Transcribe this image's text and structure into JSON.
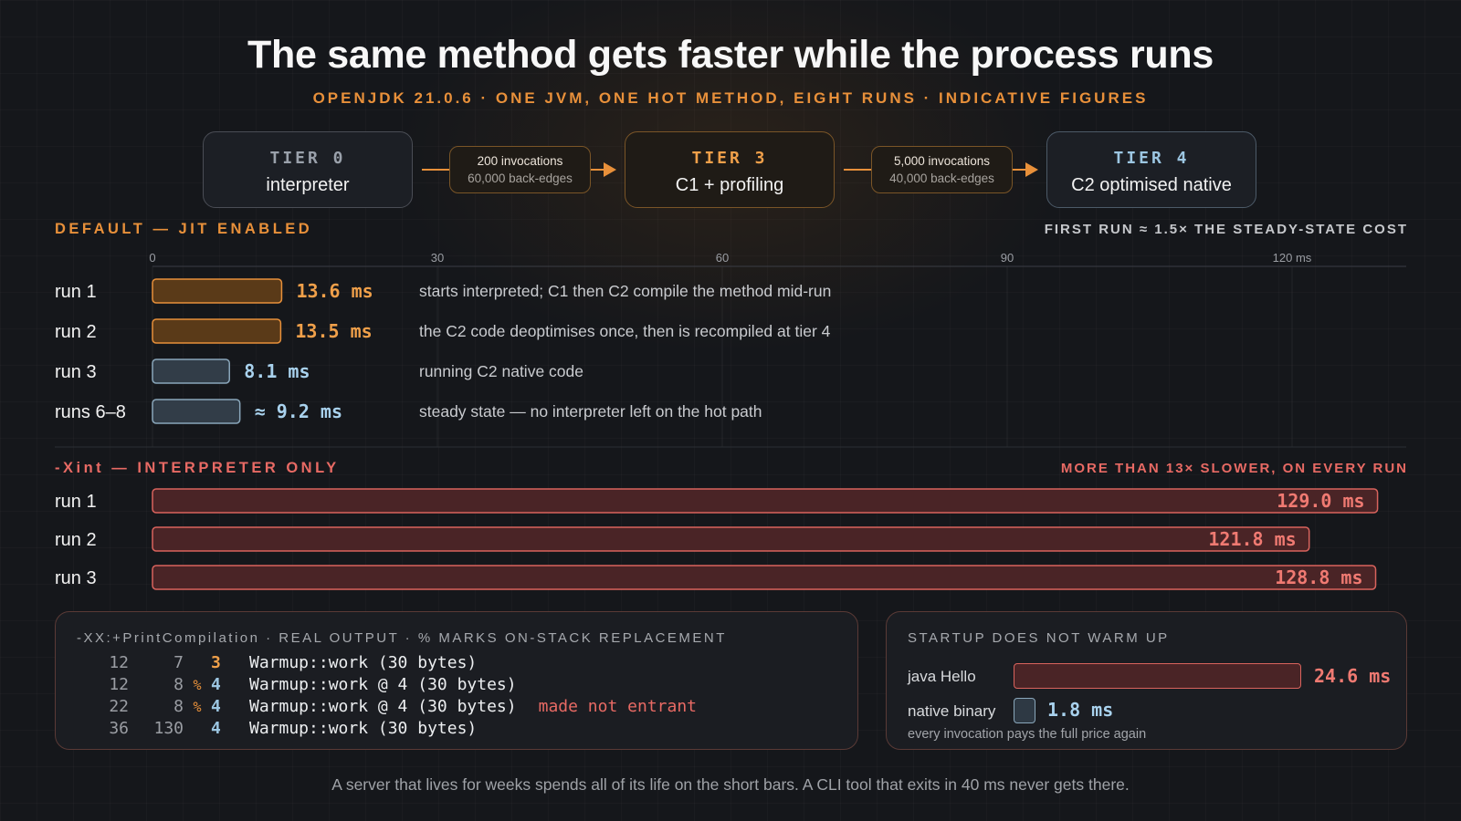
{
  "title": "The same method gets faster while the process runs",
  "subtitle": "OPENJDK 21.0.6 · ONE JVM, ONE HOT METHOD, EIGHT RUNS · INDICATIVE FIGURES",
  "tiers": [
    {
      "name": "TIER 0",
      "desc": "interpreter"
    },
    {
      "name": "TIER 3",
      "desc": "C1 + profiling"
    },
    {
      "name": "TIER 4",
      "desc": "C2 optimised native"
    }
  ],
  "thresholds": [
    {
      "line1": "200 invocations",
      "line2": "60,000 back-edges"
    },
    {
      "line1": "5,000 invocations",
      "line2": "40,000 back-edges"
    }
  ],
  "colors": {
    "jit_hot": "#e8903a",
    "jit_steady": "#9cc6e2",
    "xint": "#e86a64"
  },
  "chart_data": [
    {
      "type": "bar",
      "orientation": "horizontal",
      "title": "DEFAULT — JIT ENABLED",
      "note": "FIRST RUN ≈ 1.5× THE STEADY-STATE COST",
      "x_ticks": [
        "0",
        "30",
        "60",
        "90",
        "120 ms"
      ],
      "xlim": [
        0,
        132
      ],
      "grid": true,
      "categories": [
        "run 1",
        "run 2",
        "run 3",
        "runs 6–8"
      ],
      "values": [
        13.6,
        13.5,
        8.1,
        9.2
      ],
      "value_labels": [
        "13.6 ms",
        "13.5 ms",
        "8.1 ms",
        "≈ 9.2 ms"
      ],
      "bar_style": [
        "hot",
        "hot",
        "steady",
        "steady"
      ],
      "annotations": [
        "starts interpreted; C1 then C2 compile the method mid-run",
        "the C2 code deoptimises once, then is recompiled at tier 4",
        "running C2 native code",
        "steady state — no interpreter left on the hot path"
      ]
    },
    {
      "type": "bar",
      "orientation": "horizontal",
      "title": "-Xint — INTERPRETER ONLY",
      "note": "MORE THAN 13× SLOWER, ON EVERY RUN",
      "xlim": [
        0,
        132
      ],
      "categories": [
        "run 1",
        "run 2",
        "run 3"
      ],
      "values": [
        129.0,
        121.8,
        128.8
      ],
      "value_labels": [
        "129.0 ms",
        "121.8 ms",
        "128.8 ms"
      ]
    },
    {
      "type": "bar",
      "orientation": "horizontal",
      "title": "STARTUP DOES NOT WARM UP",
      "categories": [
        "java Hello",
        "native binary"
      ],
      "values": [
        24.6,
        1.8
      ],
      "value_labels": [
        "24.6 ms",
        "1.8 ms"
      ],
      "caption": "every invocation pays the full price again"
    }
  ],
  "compilation": {
    "title": "-XX:+PrintCompilation · REAL OUTPUT · % MARKS ON-STACK REPLACEMENT",
    "lines": [
      {
        "ts": "12",
        "id": "7",
        "flag": "",
        "level": "3",
        "method": "Warmup::work (30 bytes)",
        "note": ""
      },
      {
        "ts": "12",
        "id": "8",
        "flag": "%",
        "level": "4",
        "method": "Warmup::work @ 4 (30 bytes)",
        "note": ""
      },
      {
        "ts": "22",
        "id": "8",
        "flag": "%",
        "level": "4",
        "method": "Warmup::work @ 4 (30 bytes)",
        "note": "made not entrant"
      },
      {
        "ts": "36",
        "id": "130",
        "flag": "",
        "level": "4",
        "method": "Warmup::work (30 bytes)",
        "note": ""
      }
    ]
  },
  "footer": "A server that lives for weeks spends all of its life on the short bars. A CLI tool that exits in 40 ms never gets there."
}
